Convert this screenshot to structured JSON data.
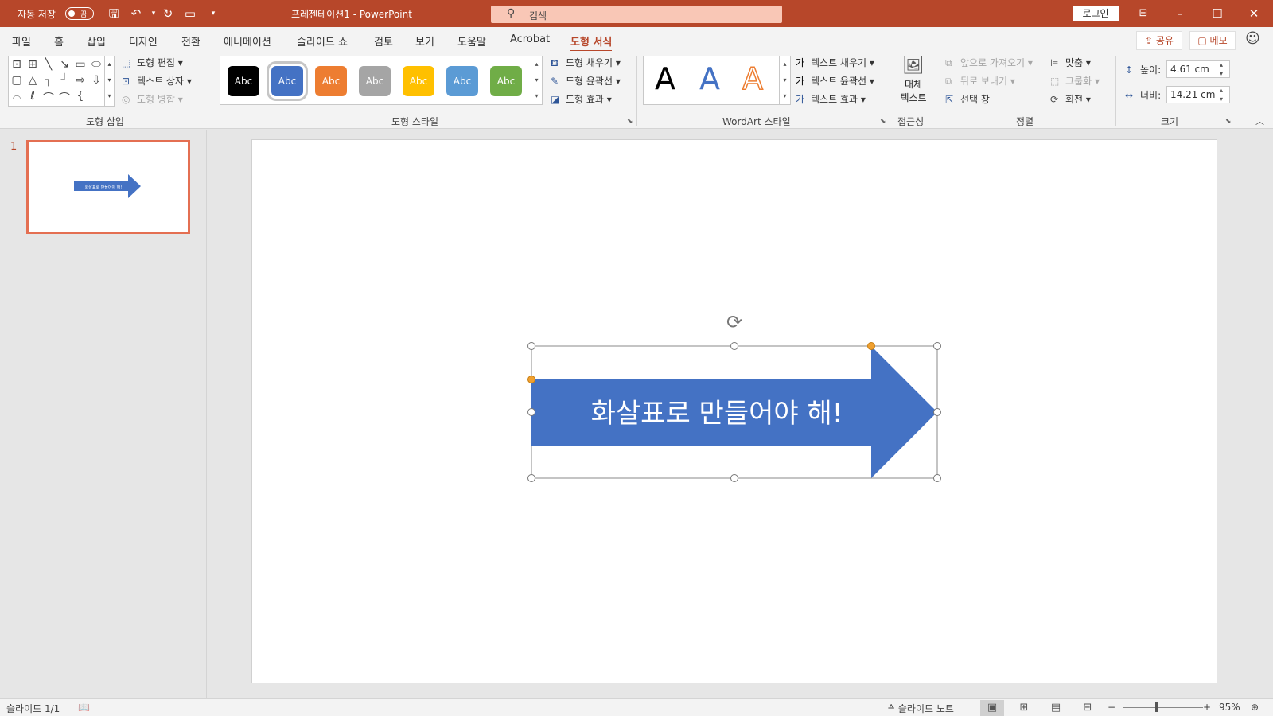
{
  "titlebar": {
    "autosave_label": "자동 저장",
    "autosave_state": "끔",
    "title": "프레젠테이션1  -  PowerPoint",
    "search_placeholder": "검색",
    "login_label": "로그인"
  },
  "tabs": [
    "파일",
    "홈",
    "삽입",
    "디자인",
    "전환",
    "애니메이션",
    "슬라이드 쇼",
    "검토",
    "보기",
    "도움말",
    "Acrobat",
    "도형 서식"
  ],
  "active_tab": "도형 서식",
  "share_label": "공유",
  "memo_label": "메모",
  "ribbon": {
    "insert_shapes": {
      "label": "도형 삽입",
      "edit_shape": "도형 편집",
      "text_box": "텍스트 상자",
      "merge_shapes": "도형 병합"
    },
    "shape_styles": {
      "label": "도형 스타일",
      "swatch_text": "Abc",
      "swatch_colors": [
        "#000000",
        "#4472c4",
        "#ed7d31",
        "#a5a5a5",
        "#ffc000",
        "#5b9bd5",
        "#70ad47"
      ],
      "shape_fill": "도형 채우기",
      "shape_outline": "도형 윤곽선",
      "shape_effects": "도형 효과"
    },
    "wordart_styles": {
      "label": "WordArt 스타일",
      "sample_letter": "A",
      "text_fill": "텍스트 채우기",
      "text_outline": "텍스트 윤곽선",
      "text_effects": "텍스트 효과"
    },
    "accessibility": {
      "label": "접근성",
      "alt_text_line1": "대체",
      "alt_text_line2": "텍스트"
    },
    "arrange": {
      "label": "정렬",
      "bring_forward": "앞으로 가져오기",
      "send_backward": "뒤로 보내기",
      "selection_pane": "선택 창",
      "align": "맞춤",
      "group": "그룹화",
      "rotate": "회전"
    },
    "size": {
      "label": "크기",
      "height_label": "높이:",
      "height_value": "4.61 cm",
      "width_label": "너비:",
      "width_value": "14.21 cm"
    }
  },
  "thumbnails": [
    {
      "number": "1",
      "text": "화살표로 만들어야 해!"
    }
  ],
  "slide": {
    "arrow_text": "화살표로 만들어야 해!",
    "arrow_fill": "#4472c4",
    "accent": "#b7472a"
  },
  "statusbar": {
    "slide_counter": "슬라이드 1/1",
    "notes_label": "슬라이드 노트",
    "zoom": "95%"
  }
}
